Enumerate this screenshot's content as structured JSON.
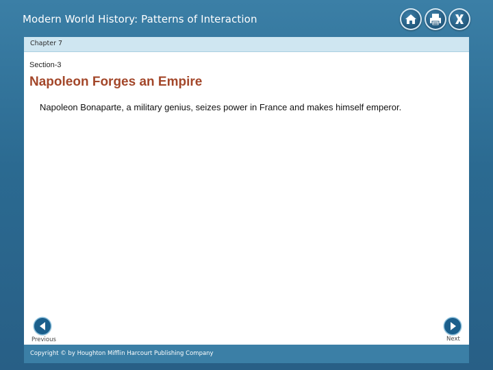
{
  "header": {
    "book_title": "Modern World History: Patterns of Interaction",
    "icons": [
      "home-icon",
      "print-icon",
      "close-icon"
    ]
  },
  "chapter": {
    "label": "Chapter 7"
  },
  "content": {
    "section": "Section-3",
    "title": "Napoleon Forges an Empire",
    "summary": "Napoleon Bonaparte, a military genius, seizes power in France and makes himself emperor."
  },
  "navigation": {
    "previous_label": "Previous",
    "next_label": "Next"
  },
  "footer": {
    "copyright": "Copyright © by Houghton Mifflin Harcourt Publishing Company"
  },
  "colors": {
    "background": "#2f6e95",
    "chapter_bar": "#cfe6f1",
    "title_accent": "#a3472a",
    "footer": "#3b7fa6"
  }
}
